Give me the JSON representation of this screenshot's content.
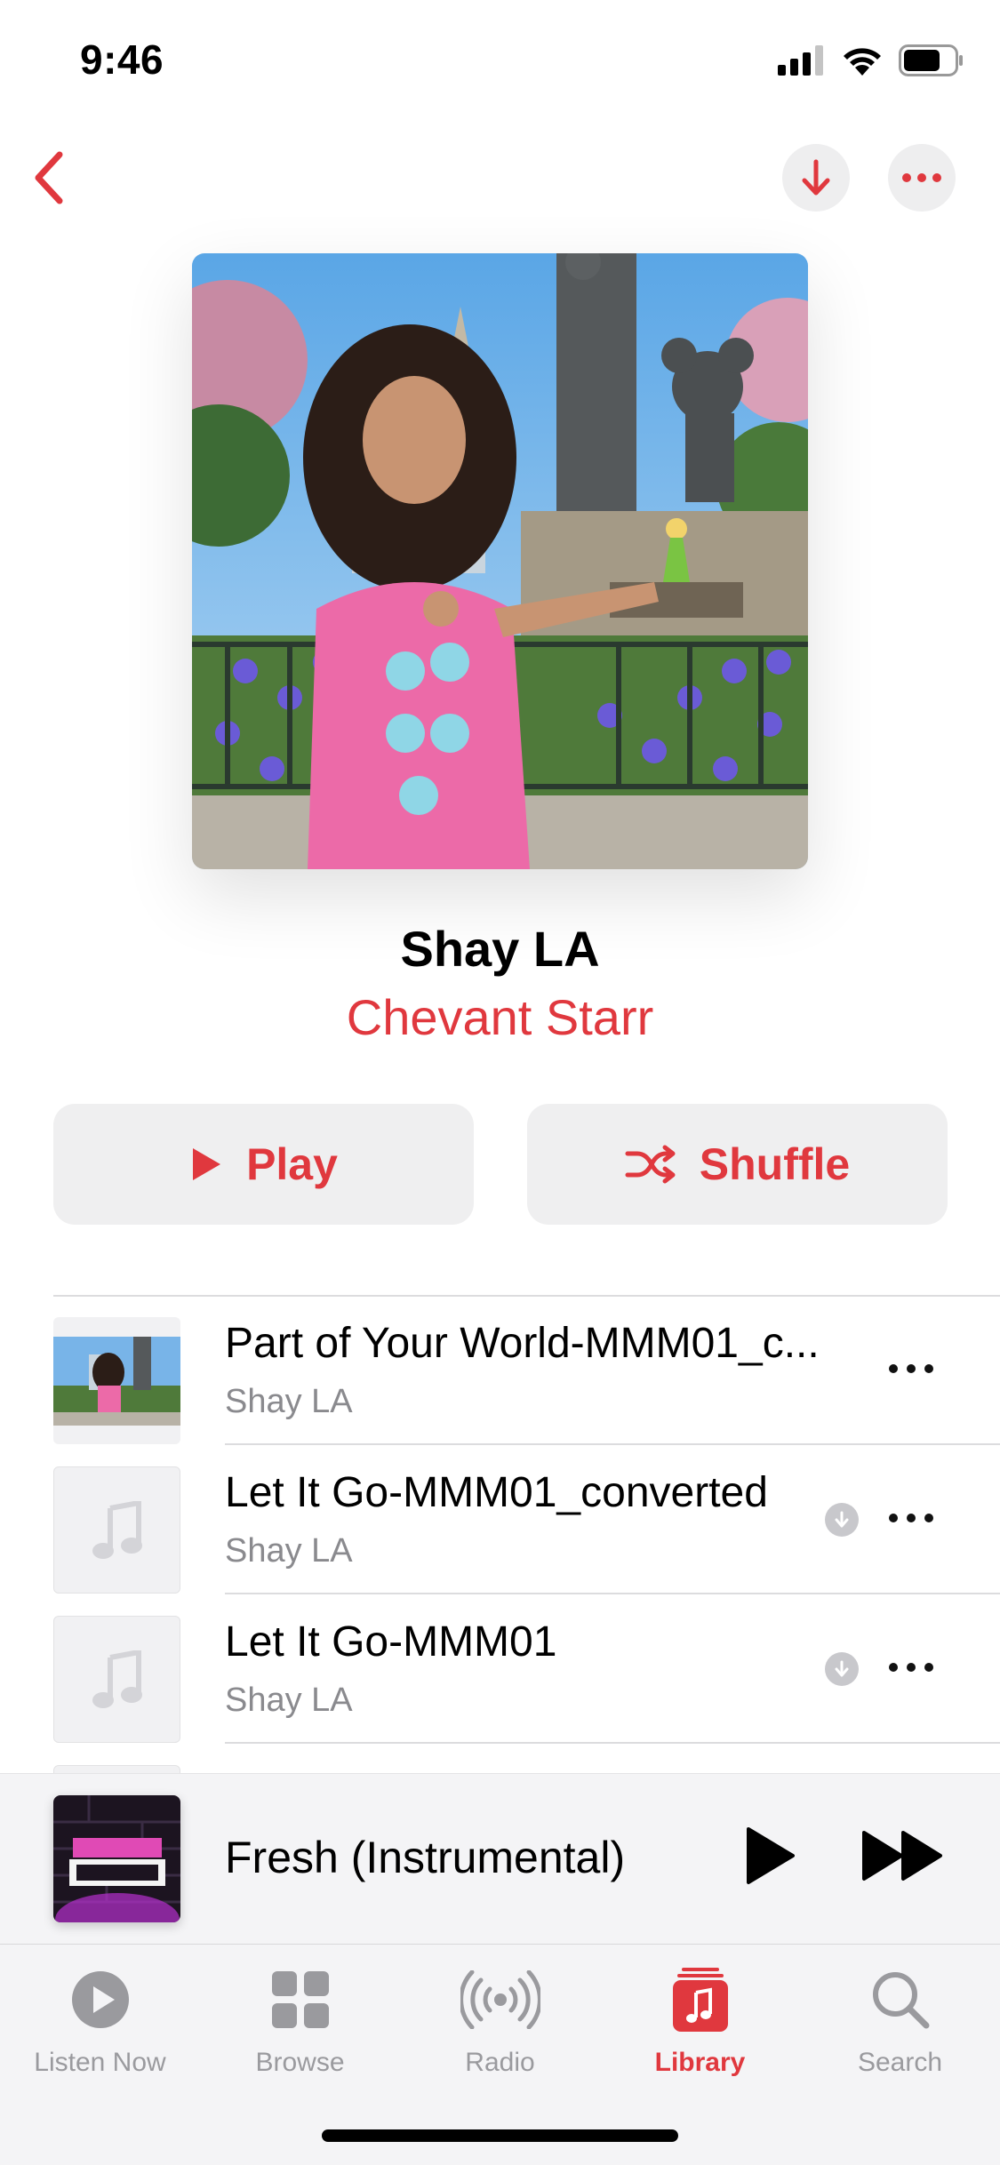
{
  "status_bar": {
    "time": "9:46"
  },
  "album": {
    "title": "Shay LA",
    "artist": "Chevant Starr"
  },
  "actions": {
    "play_label": "Play",
    "shuffle_label": "Shuffle"
  },
  "tracks": [
    {
      "title": "Part of Your World-MMM01_c...",
      "artist": "Shay LA",
      "artwork": "photo",
      "downloadable": false
    },
    {
      "title": "Let It Go-MMM01_converted",
      "artist": "Shay LA",
      "artwork": "music-note-icon",
      "downloadable": true
    },
    {
      "title": "Let It Go-MMM01",
      "artist": "Shay LA",
      "artwork": "music-note-icon",
      "downloadable": true
    }
  ],
  "mini_player": {
    "title": "Fresh (Instrumental)"
  },
  "tabs": [
    {
      "label": "Listen Now",
      "icon": "play-circle-icon",
      "active": false
    },
    {
      "label": "Browse",
      "icon": "grid-icon",
      "active": false
    },
    {
      "label": "Radio",
      "icon": "radio-waves-icon",
      "active": false
    },
    {
      "label": "Library",
      "icon": "music-library-icon",
      "active": true
    },
    {
      "label": "Search",
      "icon": "search-icon",
      "active": false
    }
  ],
  "colors": {
    "accent": "#e0383e",
    "secondary_text": "#8a8a8e",
    "button_bg": "#efeff0"
  }
}
